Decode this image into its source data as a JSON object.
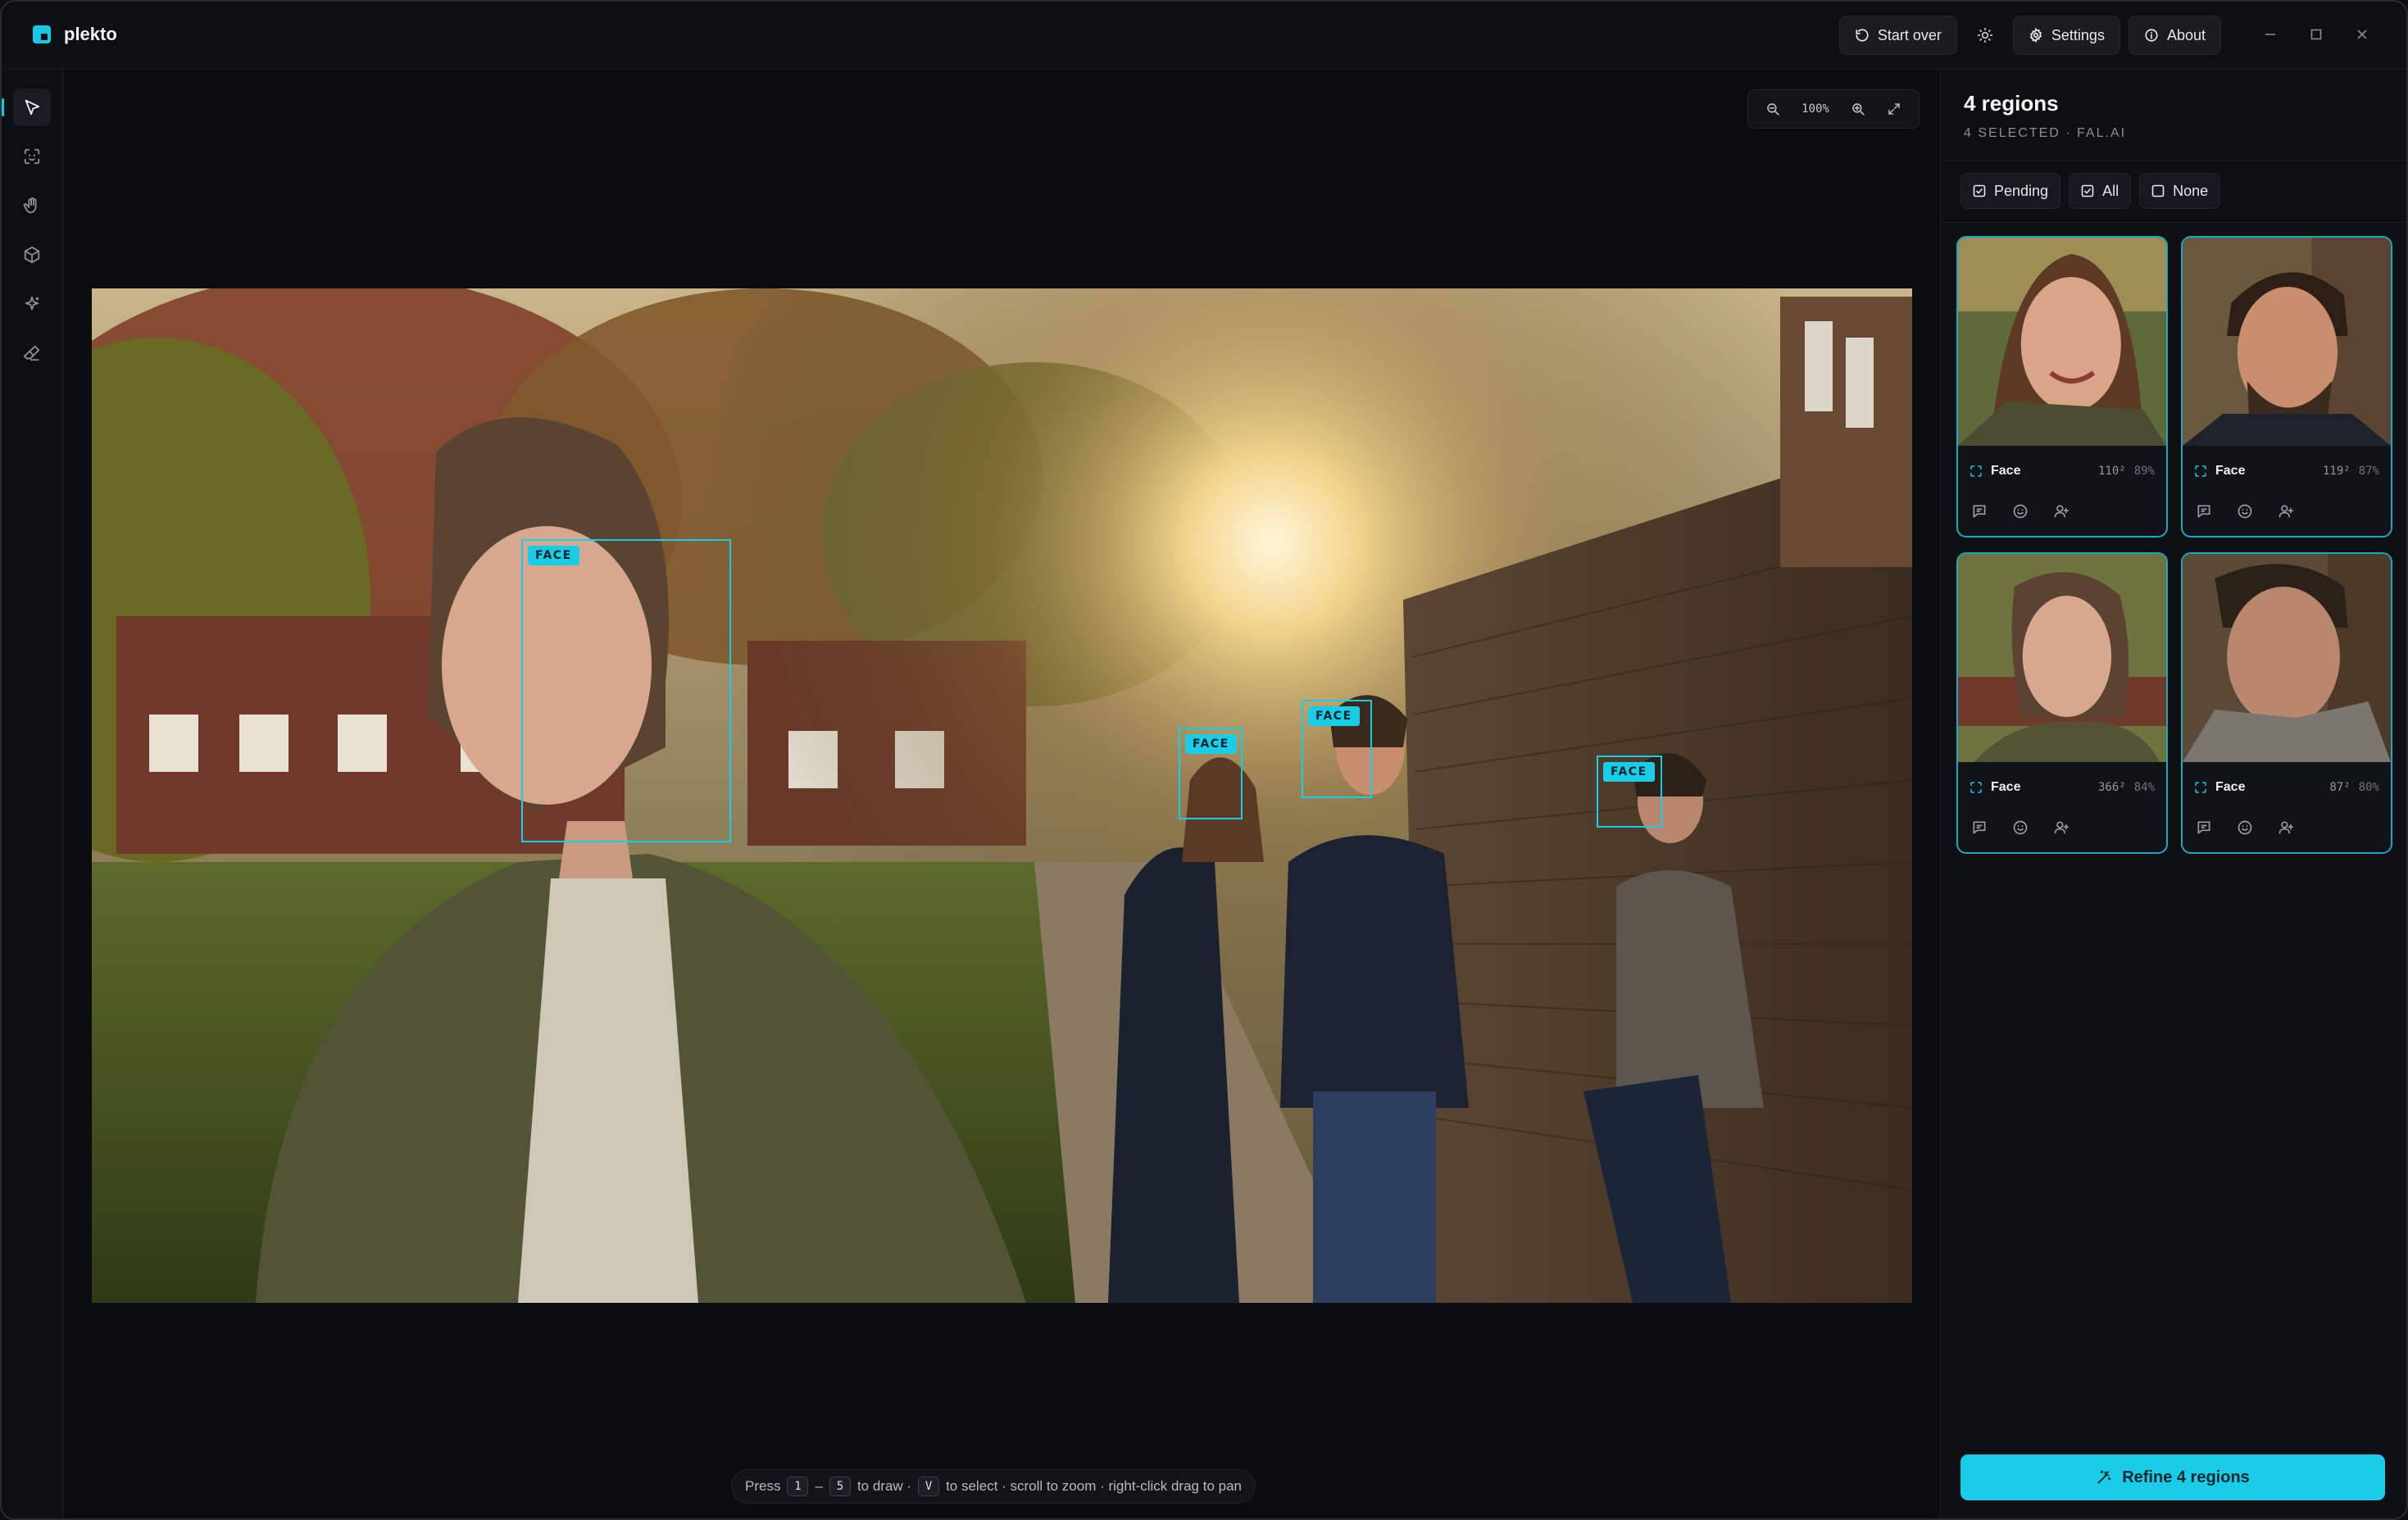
{
  "app": {
    "name": "plekto"
  },
  "titlebar": {
    "start_over": "Start over",
    "settings": "Settings",
    "about": "About"
  },
  "tools": [
    "pointer-icon",
    "face-scan-icon",
    "hand-icon",
    "cube-icon",
    "sparkles-icon",
    "eraser-icon"
  ],
  "zoom": {
    "value": "100%"
  },
  "faces": [
    {
      "tag": "FACE"
    },
    {
      "tag": "FACE"
    },
    {
      "tag": "FACE"
    },
    {
      "tag": "FACE"
    }
  ],
  "hint": {
    "press": "Press",
    "key_from": "1",
    "dash": "–",
    "key_to": "5",
    "to_draw": "to draw ·",
    "key_select": "V",
    "rest": "to select · scroll to zoom · right-click drag to pan"
  },
  "panel": {
    "title": "4 regions",
    "subtitle": "4 SELECTED · FAL.AI",
    "filters": {
      "pending": "Pending",
      "all": "All",
      "none": "None"
    },
    "cards": [
      {
        "label": "Face",
        "size": "110²",
        "conf": "89%"
      },
      {
        "label": "Face",
        "size": "119²",
        "conf": "87%"
      },
      {
        "label": "Face",
        "size": "366²",
        "conf": "84%"
      },
      {
        "label": "Face",
        "size": "87²",
        "conf": "80%"
      }
    ],
    "refine": "Refine 4 regions"
  },
  "colors": {
    "accent": "#19cde8",
    "background": "#0d0e12"
  }
}
